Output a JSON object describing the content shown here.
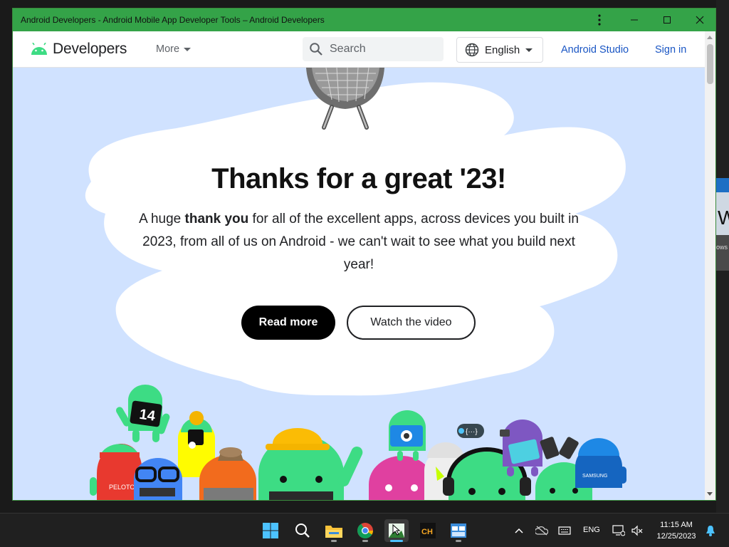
{
  "window": {
    "title": "Android Developers - Android Mobile App Developer Tools – Android Developers"
  },
  "header": {
    "logo_text": "Developers",
    "more_label": "More",
    "search_placeholder": "Search",
    "language_label": "English",
    "android_studio_label": "Android Studio",
    "sign_in_label": "Sign in"
  },
  "hero": {
    "title": "Thanks for a great '23!",
    "text_before": "A huge ",
    "text_bold": "thank you",
    "text_after": " for all of the excellent apps, across devices you built in 2023, from all of us on Android - we can't wait to see what you build next year!",
    "read_more_label": "Read more",
    "watch_video_label": "Watch the video",
    "bot_badge_14": "14",
    "bot_badge_peloton": "PELOTON",
    "bot_badge_samsung": "SAMSUNG",
    "bot_bubble": "{···}"
  },
  "taskbar": {
    "apps": [
      "start",
      "search",
      "file-explorer",
      "chrome",
      "active-app",
      "ch-app",
      "window-app"
    ],
    "language": "ENG",
    "time": "11:15 AM",
    "date": "12/25/2023"
  },
  "desktop": {
    "partial_text": "W",
    "partial_label": "ows"
  },
  "colors": {
    "titlebar": "#34a348",
    "hero_bg": "#d0e2ff",
    "link": "#1a56c4",
    "android_green": "#3ddc84"
  }
}
